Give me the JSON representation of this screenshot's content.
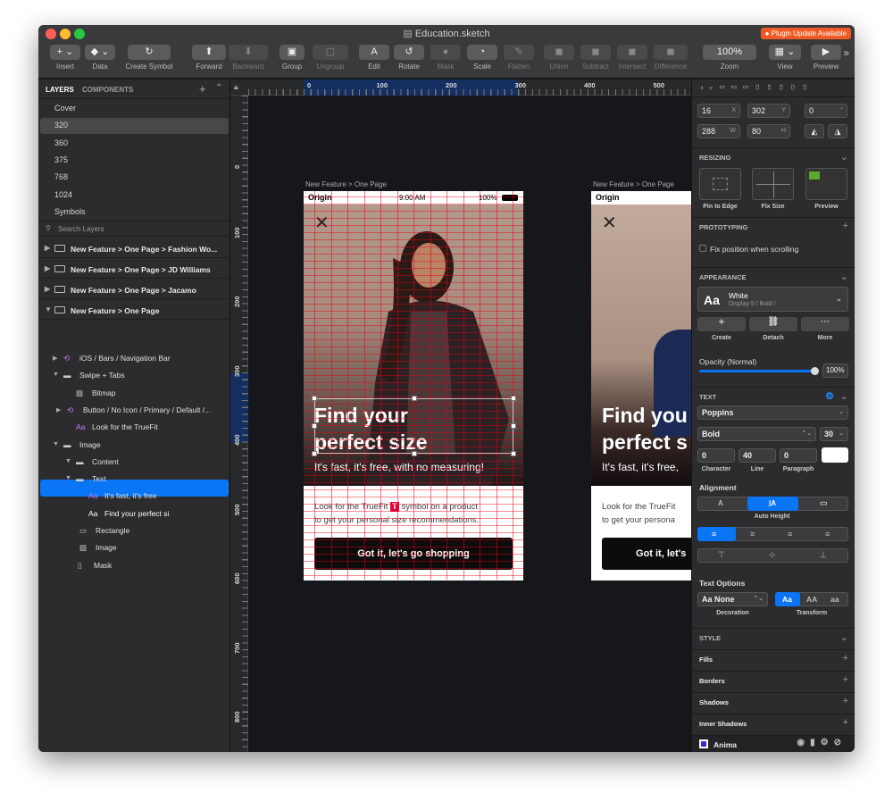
{
  "window": {
    "title": "Education.sketch",
    "plugin_badge": "Plugin Update Available"
  },
  "toolbar": [
    {
      "label": "Insert",
      "glyph": "+ ⌄"
    },
    {
      "label": "Data",
      "glyph": "◆ ⌄"
    },
    {
      "label": "Create Symbol",
      "glyph": "↻"
    },
    {
      "label": "Forward",
      "glyph": "⬆"
    },
    {
      "label": "Backward",
      "glyph": "⬇"
    },
    {
      "label": "Group",
      "glyph": "▣"
    },
    {
      "label": "Ungroup",
      "glyph": "▢"
    },
    {
      "label": "Edit",
      "glyph": "A"
    },
    {
      "label": "Rotate",
      "glyph": "↺"
    },
    {
      "label": "Mask",
      "glyph": "●"
    },
    {
      "label": "Scale",
      "glyph": "◔"
    },
    {
      "label": "Flatten",
      "glyph": "✎"
    },
    {
      "label": "Union",
      "glyph": "◼"
    },
    {
      "label": "Subtract",
      "glyph": "◼"
    },
    {
      "label": "Intersect",
      "glyph": "◼"
    },
    {
      "label": "Difference",
      "glyph": "◼"
    },
    {
      "label": "Zoom",
      "glyph": "100%"
    },
    {
      "label": "View",
      "glyph": "▦ ⌄"
    },
    {
      "label": "Preview",
      "glyph": "▶"
    }
  ],
  "layers_panel": {
    "tab_layers": "LAYERS",
    "tab_components": "COMPONENTS",
    "pages": [
      "Cover",
      "320",
      "360",
      "375",
      "768",
      "1024",
      "Symbols"
    ],
    "selected_page": "320",
    "search_placeholder": "Search Layers",
    "artboards": [
      "New Feature > One Page > Fashion Wo...",
      "New Feature > One Page > JD Williams",
      "New Feature > One Page > Jacamo",
      "New Feature > One Page"
    ],
    "tree": [
      "iOS / Bars / Navigation Bar",
      "Swipe + Tabs",
      "Bitmap",
      "Button / No Icon / Primary / Default /...",
      "Look for the TrueFit",
      "Image",
      "Content",
      "Text",
      "It's fast, it's free",
      "Find your perfect si",
      "Rectangle",
      "Image",
      "Mask"
    ]
  },
  "ruler": {
    "h_ticks": [
      "0",
      "100",
      "200",
      "300",
      "400",
      "500"
    ],
    "v_ticks": [
      "0",
      "100",
      "200",
      "300",
      "400",
      "500",
      "600",
      "700",
      "800"
    ]
  },
  "artboard": {
    "label": "New Feature > One Page",
    "status_brand": "Origin",
    "status_time": "9:00 AM",
    "status_battery": "100%",
    "headline_1": "Find your",
    "headline_2": "perfect size",
    "subhead": "It's fast, it's free, with no measuring!",
    "body_1": "Look for the TrueFit",
    "body_2": "symbol on a product",
    "body_3": "to get your personal size recommendations.",
    "truefit_glyph": "T",
    "cta": "Got it, let's go shopping"
  },
  "artboard2": {
    "label": "New Feature > One Page",
    "status_brand": "Origin",
    "headline_1": "Find you",
    "headline_2": "perfect s",
    "subhead": "It's fast, it's free,",
    "body_1": "Look for the TrueFit",
    "body_2": "to get your persona",
    "cta": "Got it, let's"
  },
  "inspector": {
    "x": "16",
    "x_unit": "X",
    "y": "302",
    "y_unit": "Y",
    "rot": "0",
    "rot_unit": "°",
    "w": "288",
    "w_unit": "W",
    "h": "80",
    "h_unit": "H",
    "resizing": "RESIZING",
    "pin_to_edge": "Pin to Edge",
    "fix_size": "Fix Size",
    "preview": "Preview",
    "prototyping": "PROTOTYPING",
    "fix_position": "Fix position when scrolling",
    "appearance": "APPEARANCE",
    "style_name": "White",
    "style_path": "Display 5 / Bold /",
    "style_glyph": "Aa",
    "create": "Create",
    "detach": "Detach",
    "more": "More",
    "opacity_label": "Opacity (Normal)",
    "opacity_value": "100%",
    "opacity_fraction": 1.0,
    "text_section": "TEXT",
    "font_family": "Poppins",
    "font_weight": "Bold",
    "font_size": "30",
    "character": "0",
    "line": "40",
    "paragraph": "0",
    "character_label": "Character",
    "line_label": "Line",
    "paragraph_label": "Paragraph",
    "alignment": "Alignment",
    "auto_height": "Auto Height",
    "text_options": "Text Options",
    "decoration_value": "Aa None",
    "decoration": "Decoration",
    "transform": "Transform",
    "transform_options": [
      "Aa",
      "AA",
      "aa"
    ],
    "style": "STYLE",
    "fills": "Fills",
    "borders": "Borders",
    "shadows": "Shadows",
    "inner_shadows": "Inner Shadows",
    "anima": "Anima"
  },
  "colors": {
    "accent": "#0a75f5",
    "guide": "#e60014",
    "badge": "#ef5a24",
    "truefit": "#e4003b"
  }
}
